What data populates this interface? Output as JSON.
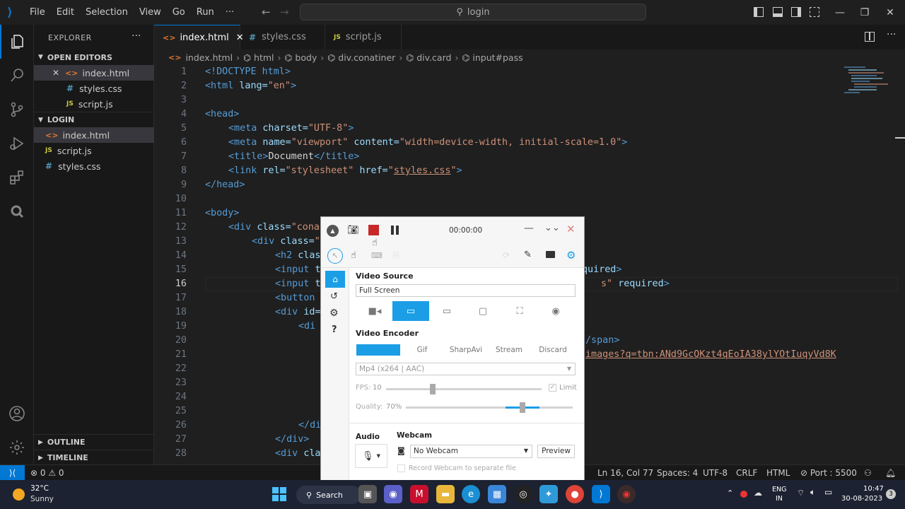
{
  "titlebar": {
    "menu": [
      "File",
      "Edit",
      "Selection",
      "View",
      "Go",
      "Run",
      "···"
    ],
    "search": "login",
    "nav_back": "←",
    "nav_fwd": "→"
  },
  "sidebar": {
    "title": "EXPLORER",
    "more": "···",
    "open_editors": "OPEN EDITORS",
    "open_files": [
      {
        "name": "index.html",
        "type": "html",
        "close": "✕"
      },
      {
        "name": "styles.css",
        "type": "css"
      },
      {
        "name": "script.js",
        "type": "js"
      }
    ],
    "folder": "LOGIN",
    "folder_files": [
      {
        "name": "index.html",
        "type": "html"
      },
      {
        "name": "script.js",
        "type": "js"
      },
      {
        "name": "styles.css",
        "type": "css"
      }
    ],
    "outline": "OUTLINE",
    "timeline": "TIMELINE"
  },
  "tabs": [
    {
      "name": "index.html",
      "icon": "<>",
      "close": "✕"
    },
    {
      "name": "styles.css",
      "icon": "#"
    },
    {
      "name": "script.js",
      "icon": "JS"
    }
  ],
  "breadcrumb": [
    "index.html",
    "html",
    "body",
    "div.conatiner",
    "div.card",
    "input#pass"
  ],
  "code": {
    "lines": [
      "1",
      "2",
      "3",
      "4",
      "5",
      "6",
      "7",
      "8",
      "9",
      "10",
      "11",
      "12",
      "13",
      "14",
      "15",
      "16",
      "17",
      "18",
      "19",
      "20",
      "21",
      "22",
      "23",
      "24",
      "25",
      "26",
      "27",
      "28"
    ],
    "current_line": "16",
    "l1": "<!DOCTYPE html>",
    "l2a": "<html ",
    "l2b": "lang=",
    "l2c": "\"en\"",
    "l2d": ">",
    "l4": "<head>",
    "l5a": "<meta ",
    "l5b": "charset=",
    "l5c": "\"UTF-8\"",
    "l5d": ">",
    "l6a": "<meta ",
    "l6b": "name=",
    "l6c": "\"viewport\" ",
    "l6d": "content=",
    "l6e": "\"width=device-width, initial-scale=1.0\"",
    "l6f": ">",
    "l7a": "<title>",
    "l7b": "Document",
    "l7c": "</title>",
    "l8a": "<link ",
    "l8b": "rel=",
    "l8c": "\"stylesheet\" ",
    "l8d": "href=",
    "l8e": "\"",
    "l8f": "styles.css",
    "l8g": "\"",
    "l8h": ">",
    "l9": "</head>",
    "l11": "<body>",
    "l12a": "<div ",
    "l12b": "class=",
    "l12c": "\"cona",
    "l13a": "<div ",
    "l13b": "class=",
    "l13c": "\"",
    "l14a": "<h2 ",
    "l14b": "clas",
    "l15a": "<input ",
    "l15b": "t",
    "l15c": "quired",
    "l15d": ">",
    "l16a": "<input ",
    "l16b": "t",
    "l16c": "s\" ",
    "l16d": "required",
    "l16e": ">",
    "l17": "<button",
    "l18a": "<div ",
    "l18b": "id=",
    "l19": "<di",
    "l20a": "/span",
    "l20b": ">",
    "l21": "images?q=tbn:ANd9GcQKzt4qEoIA38ylYOtIuqyVd8K",
    "l26": "</di",
    "l27": "</div>",
    "l28a": "<div ",
    "l28b": "cla"
  },
  "statusbar": {
    "remote": "⟩⟨",
    "problems": "⊗ 0 ⚠ 0",
    "position": "Ln 16, Col 77",
    "spaces": "Spaces: 4",
    "encoding": "UTF-8",
    "eol": "CRLF",
    "language": "HTML",
    "port": "⊘ Port : 5500"
  },
  "recorder": {
    "timer": "00:00:00",
    "video_source_label": "Video Source",
    "video_source_value": "Full Screen",
    "video_encoder_label": "Video Encoder",
    "encoders": [
      "Gif",
      "SharpAvi",
      "Stream",
      "Discard"
    ],
    "encoder_selected": "",
    "format": "Mp4 (x264 | AAC)",
    "fps_label": "FPS:",
    "fps": "10",
    "fps_level": 0.3,
    "limit": "Limit",
    "quality_label": "Quality:",
    "quality": "70%",
    "quality_level": 0.7,
    "audio_label": "Audio",
    "webcam_label": "Webcam",
    "webcam_value": "No Webcam",
    "preview": "Preview",
    "record_webcam": "Record Webcam to separate file"
  },
  "taskbar": {
    "weather_temp": "32°C",
    "weather_desc": "Sunny",
    "search": "Search",
    "lang1": "ENG",
    "lang2": "IN",
    "time": "10:47",
    "date": "30-08-2023",
    "badge": "3"
  },
  "colors": {
    "accent": "#0078d4",
    "record_red": "#c82828",
    "recorder_blue": "#1b9ee6"
  }
}
